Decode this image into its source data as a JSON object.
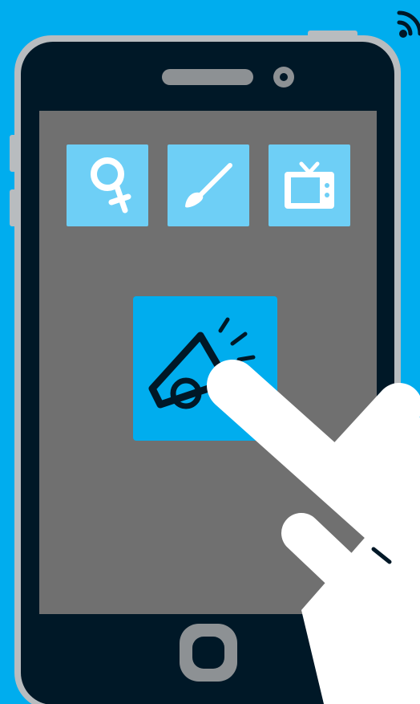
{
  "scene": {
    "background_color": "#00adee",
    "phone_body_color": "#001827",
    "phone_frame_color": "#b8bcbf",
    "screen_color": "#707070",
    "tile_color": "#6ecff6",
    "featured_tile_color": "#00adee",
    "hand_color": "#ffffff"
  },
  "icons": {
    "signal": "wifi-signal-icon",
    "speaker": "speaker-grille-icon",
    "camera": "front-camera-icon",
    "tile_1": "female-symbol-icon",
    "tile_2": "paintbrush-icon",
    "tile_3": "tv-icon",
    "featured": "megaphone-icon",
    "home": "home-button-icon",
    "hand": "pointing-hand-icon"
  }
}
